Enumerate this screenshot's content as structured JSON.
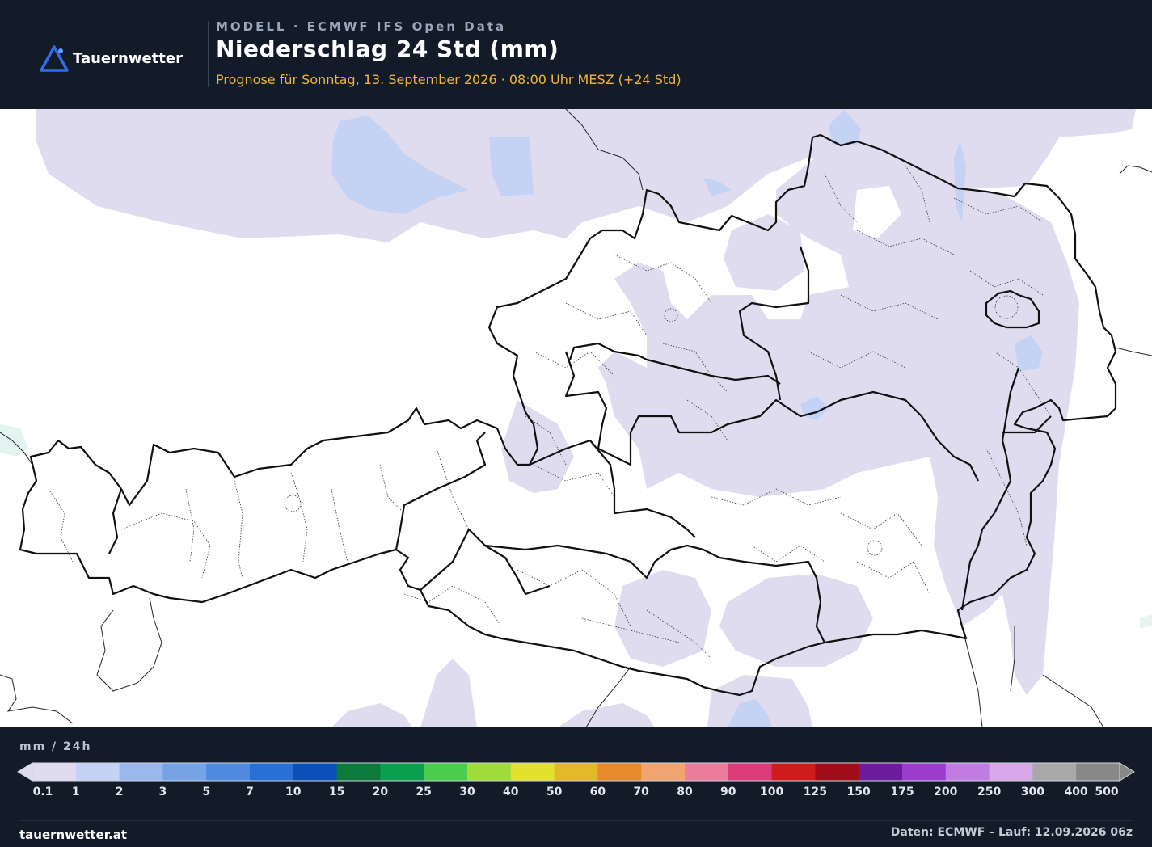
{
  "brand": {
    "name": "Tauernwetter",
    "accent": "#2f6fe6"
  },
  "header": {
    "model_label": "MODELL · ECMWF IFS Open Data",
    "title": "Niederschlag 24 Std (mm)",
    "subtitle": "Prognose für Sonntag, 13. September 2026 · 08:00 Uhr MESZ  (+24 Std)"
  },
  "legend": {
    "unit": "mm / 24h",
    "ticks": [
      "0.1",
      "1",
      "2",
      "3",
      "5",
      "7",
      "10",
      "15",
      "20",
      "25",
      "30",
      "40",
      "50",
      "60",
      "70",
      "80",
      "90",
      "100",
      "125",
      "150",
      "175",
      "200",
      "250",
      "300",
      "400",
      "500"
    ],
    "colors": [
      "#e0dcf0",
      "#c4d3f4",
      "#9ab8ec",
      "#76a2e6",
      "#4f89e0",
      "#2a6fd6",
      "#0d4fb8",
      "#0b7a3a",
      "#0ba050",
      "#4ccc4c",
      "#a0dc3c",
      "#e4e030",
      "#e4b828",
      "#e88a2c",
      "#f0a470",
      "#ec7c9c",
      "#dc3c78",
      "#cc1c1c",
      "#a00c18",
      "#6c1c9c",
      "#9c3ccc",
      "#c07ce0",
      "#d8a8e8",
      "#a8a8a8",
      "#888888"
    ]
  },
  "footer": {
    "site": "tauernwetter.at",
    "source": "Daten: ECMWF – Lauf: 12.09.2026 06z"
  },
  "map": {
    "precip_color": "#e0dcf0",
    "precip_color_2": "#c4d3f4"
  }
}
